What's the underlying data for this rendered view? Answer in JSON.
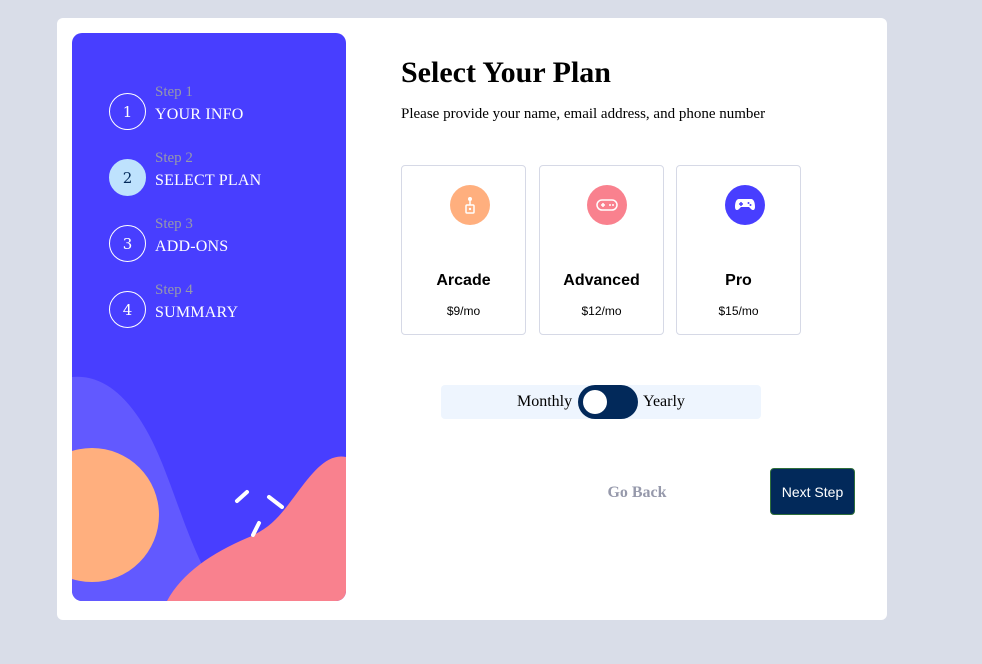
{
  "sidebar": {
    "steps": [
      {
        "number": "1",
        "label": "Step 1",
        "title": "YOUR INFO"
      },
      {
        "number": "2",
        "label": "Step 2",
        "title": "SELECT PLAN"
      },
      {
        "number": "3",
        "label": "Step 3",
        "title": "ADD-ONS"
      },
      {
        "number": "4",
        "label": "Step 4",
        "title": "SUMMARY"
      }
    ],
    "active_step": 2
  },
  "main": {
    "title": "Select Your Plan",
    "subtitle": "Please provide your name, email address, and phone number",
    "plans": [
      {
        "name": "Arcade",
        "price": "$9/mo",
        "icon": "arcade-icon",
        "color": "#ffaf7e"
      },
      {
        "name": "Advanced",
        "price": "$12/mo",
        "icon": "gamepad-icon",
        "color": "#f9818e"
      },
      {
        "name": "Pro",
        "price": "$15/mo",
        "icon": "controller-icon",
        "color": "#483eff"
      }
    ],
    "billing": {
      "monthly_label": "Monthly",
      "yearly_label": "Yearly",
      "selected": "Monthly"
    }
  },
  "footer": {
    "back_label": "Go Back",
    "next_label": "Next Step"
  },
  "colors": {
    "sidebar_bg": "#483eff",
    "primary": "#02295a",
    "active_step": "#bee2fd",
    "muted": "#9699ab",
    "page_bg": "#d9dde8"
  }
}
